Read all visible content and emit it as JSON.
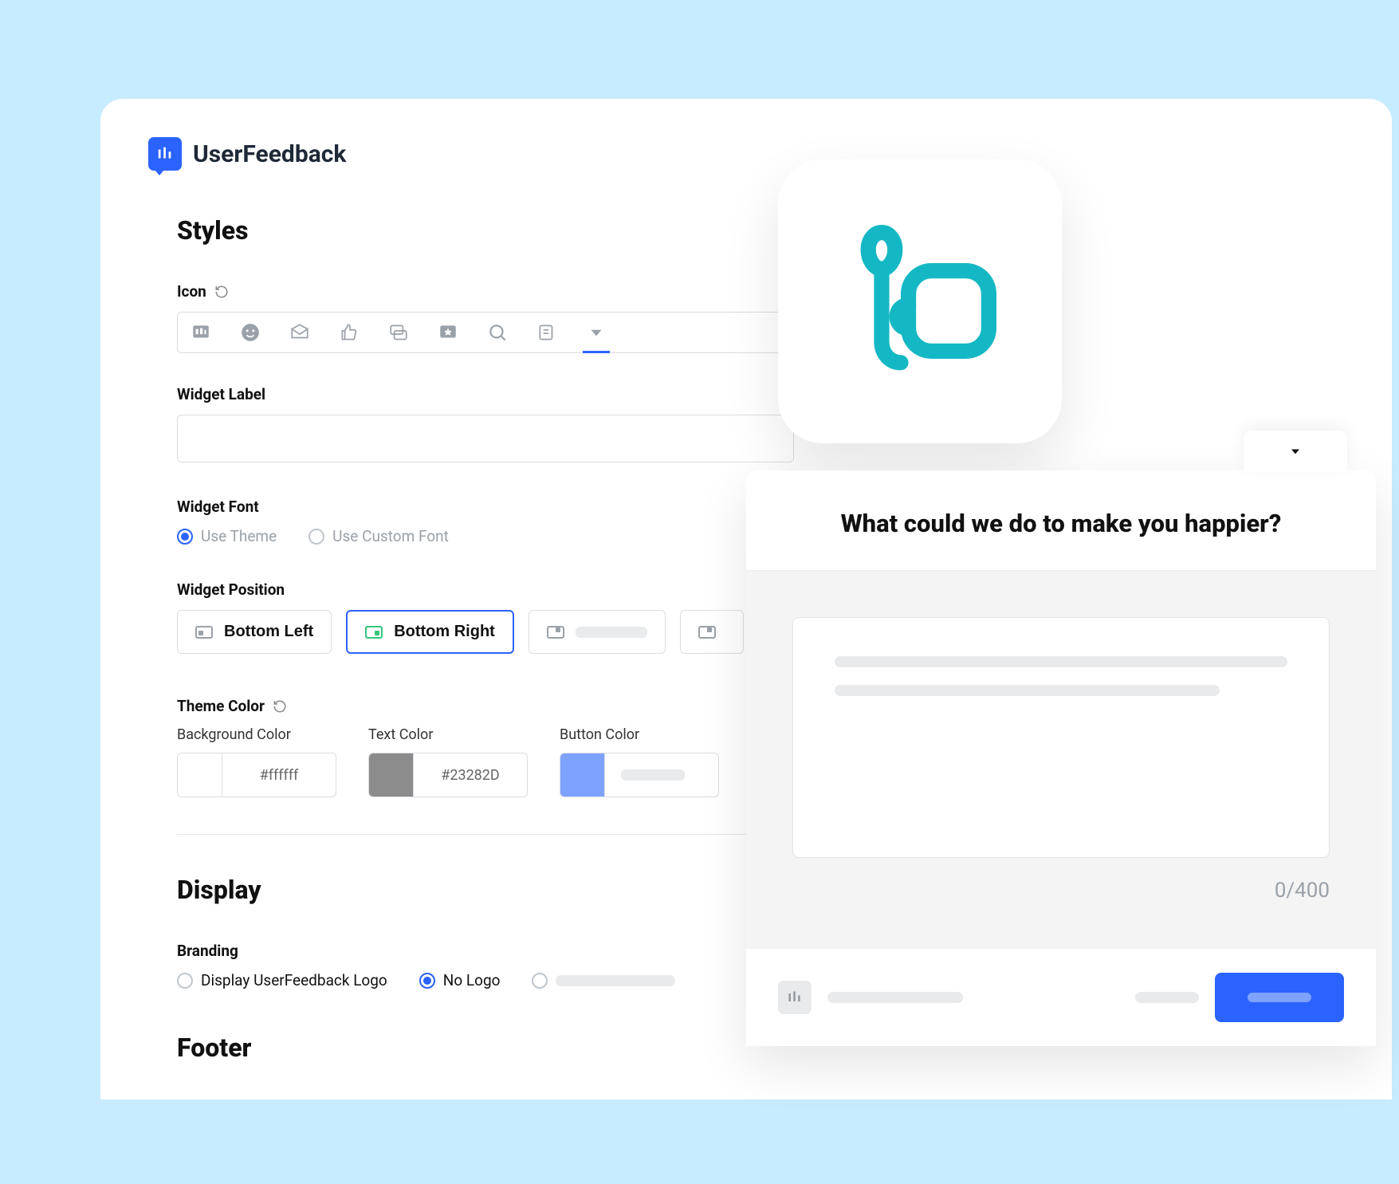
{
  "brand": "UserFeedback",
  "sections": {
    "styles": "Styles",
    "display": "Display",
    "footer": "Footer"
  },
  "fields": {
    "icon_label": "Icon",
    "widget_label": "Widget Label",
    "widget_label_value": "",
    "widget_font": "Widget Font",
    "font_options": {
      "theme": "Use Theme",
      "custom": "Use Custom Font"
    },
    "widget_position": "Widget Position",
    "positions": {
      "bl": "Bottom Left",
      "br": "Bottom Right"
    },
    "theme_color": "Theme Color",
    "colors": {
      "bg": {
        "label": "Background Color",
        "value": "#ffffff",
        "swatch": "#ffffff"
      },
      "text": {
        "label": "Text Color",
        "value": "#23282D",
        "swatch": "#8c8c8c"
      },
      "button": {
        "label": "Button Color",
        "value": "",
        "swatch": "#7ea2ff"
      }
    },
    "branding_label": "Branding",
    "branding": {
      "show": "Display UserFeedback Logo",
      "none": "No Logo"
    }
  },
  "preview": {
    "question": "What could we do to make you happier?",
    "char_count": "0/400"
  }
}
